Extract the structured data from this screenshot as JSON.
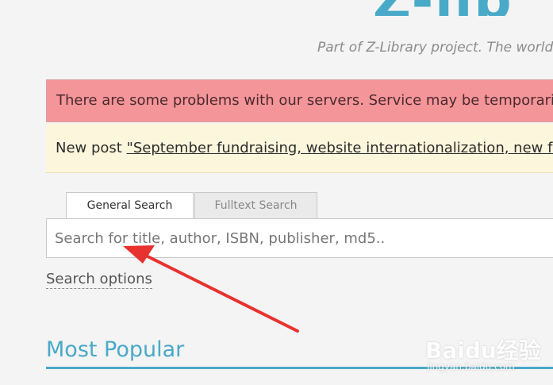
{
  "header": {
    "logo_text": "Z-lib",
    "tagline": "Part of Z-Library project. The world's largest ebook library."
  },
  "alert": {
    "text": "There are some problems with our servers. Service may be temporarily unavailable."
  },
  "post": {
    "prefix": "New post ",
    "link_text": "\"September fundraising, website internationalization, new features\""
  },
  "search": {
    "tabs": [
      "General Search",
      "Fulltext Search"
    ],
    "placeholder": "Search for title, author, ISBN, publisher, md5..",
    "options_label": "Search options"
  },
  "sections": {
    "most_popular": "Most Popular"
  },
  "watermark": {
    "main": "Baidu经验",
    "sub": "jingyan.baidu.com"
  },
  "colors": {
    "accent": "#49a9c8",
    "alert_bg": "#f4959a",
    "post_bg": "#fcf6dc",
    "annotation_arrow": "#e8322f"
  }
}
